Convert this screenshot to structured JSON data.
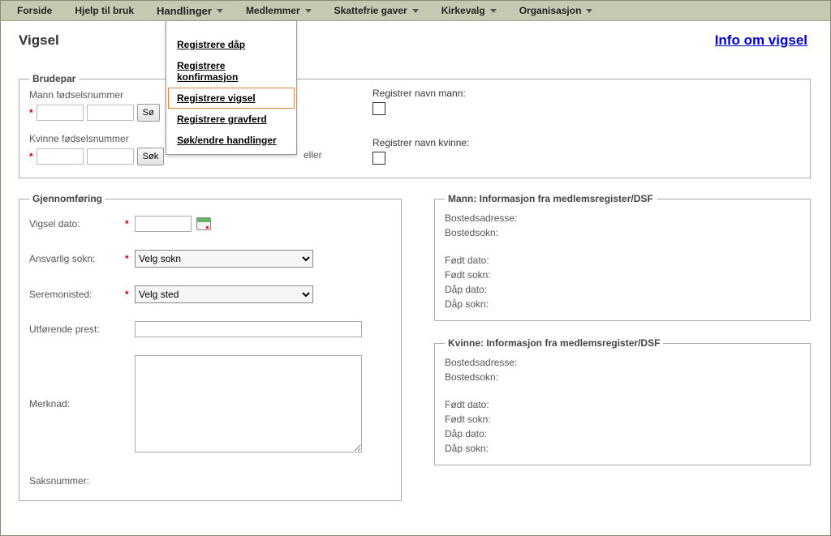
{
  "menu": {
    "items": [
      {
        "label": "Forside",
        "dropdown": false
      },
      {
        "label": "Hjelp til bruk",
        "dropdown": false
      },
      {
        "label": "Handlinger",
        "dropdown": true,
        "active": true
      },
      {
        "label": "Medlemmer",
        "dropdown": true
      },
      {
        "label": "Skattefrie gaver",
        "dropdown": true
      },
      {
        "label": "Kirkevalg",
        "dropdown": true
      },
      {
        "label": "Organisasjon",
        "dropdown": true
      }
    ]
  },
  "dropdown": {
    "items": [
      {
        "label": "Registrere dåp"
      },
      {
        "label": "Registrere konfirmasjon"
      },
      {
        "label": "Registrere vigsel",
        "selected": true
      },
      {
        "label": "Registrere gravferd"
      },
      {
        "label": "Søk/endre handlinger"
      }
    ]
  },
  "page": {
    "title": "Vigsel",
    "info_link": "Info om vigsel"
  },
  "brudepar": {
    "legend": "Brudepar",
    "mann_label": "Mann fødselsnummer",
    "kvinne_label": "Kvinne fødselsnummer",
    "sok_label": "Søk",
    "sok_label_cut": "Sø",
    "eller": "eller",
    "reg_mann": "Registrer navn mann:",
    "reg_kvinne": "Registrer navn kvinne:"
  },
  "gjennom": {
    "legend": "Gjennomføring",
    "vigsel_dato": "Vigsel dato:",
    "ansvarlig_sokn": "Ansvarlig sokn:",
    "velg_sokn": "Velg sokn",
    "seremonisted": "Seremonisted:",
    "velg_sted": "Velg sted",
    "utforende_prest": "Utførende prest:",
    "merknad": "Merknad:",
    "saksnummer": "Saksnummer:"
  },
  "mann_box": {
    "legend": "Mann: Informasjon fra medlemsregister/DSF",
    "l1": "Bostedsadresse:",
    "l2": "Bostedsokn:",
    "l3": "Født dato:",
    "l4": "Født sokn:",
    "l5": "Dåp dato:",
    "l6": "Dåp sokn:"
  },
  "kvinne_box": {
    "legend": "Kvinne: Informasjon fra medlemsregister/DSF",
    "l1": "Bostedsadresse:",
    "l2": "Bostedsokn:",
    "l3": "Født dato:",
    "l4": "Født sokn:",
    "l5": "Dåp dato:",
    "l6": "Dåp sokn:"
  }
}
